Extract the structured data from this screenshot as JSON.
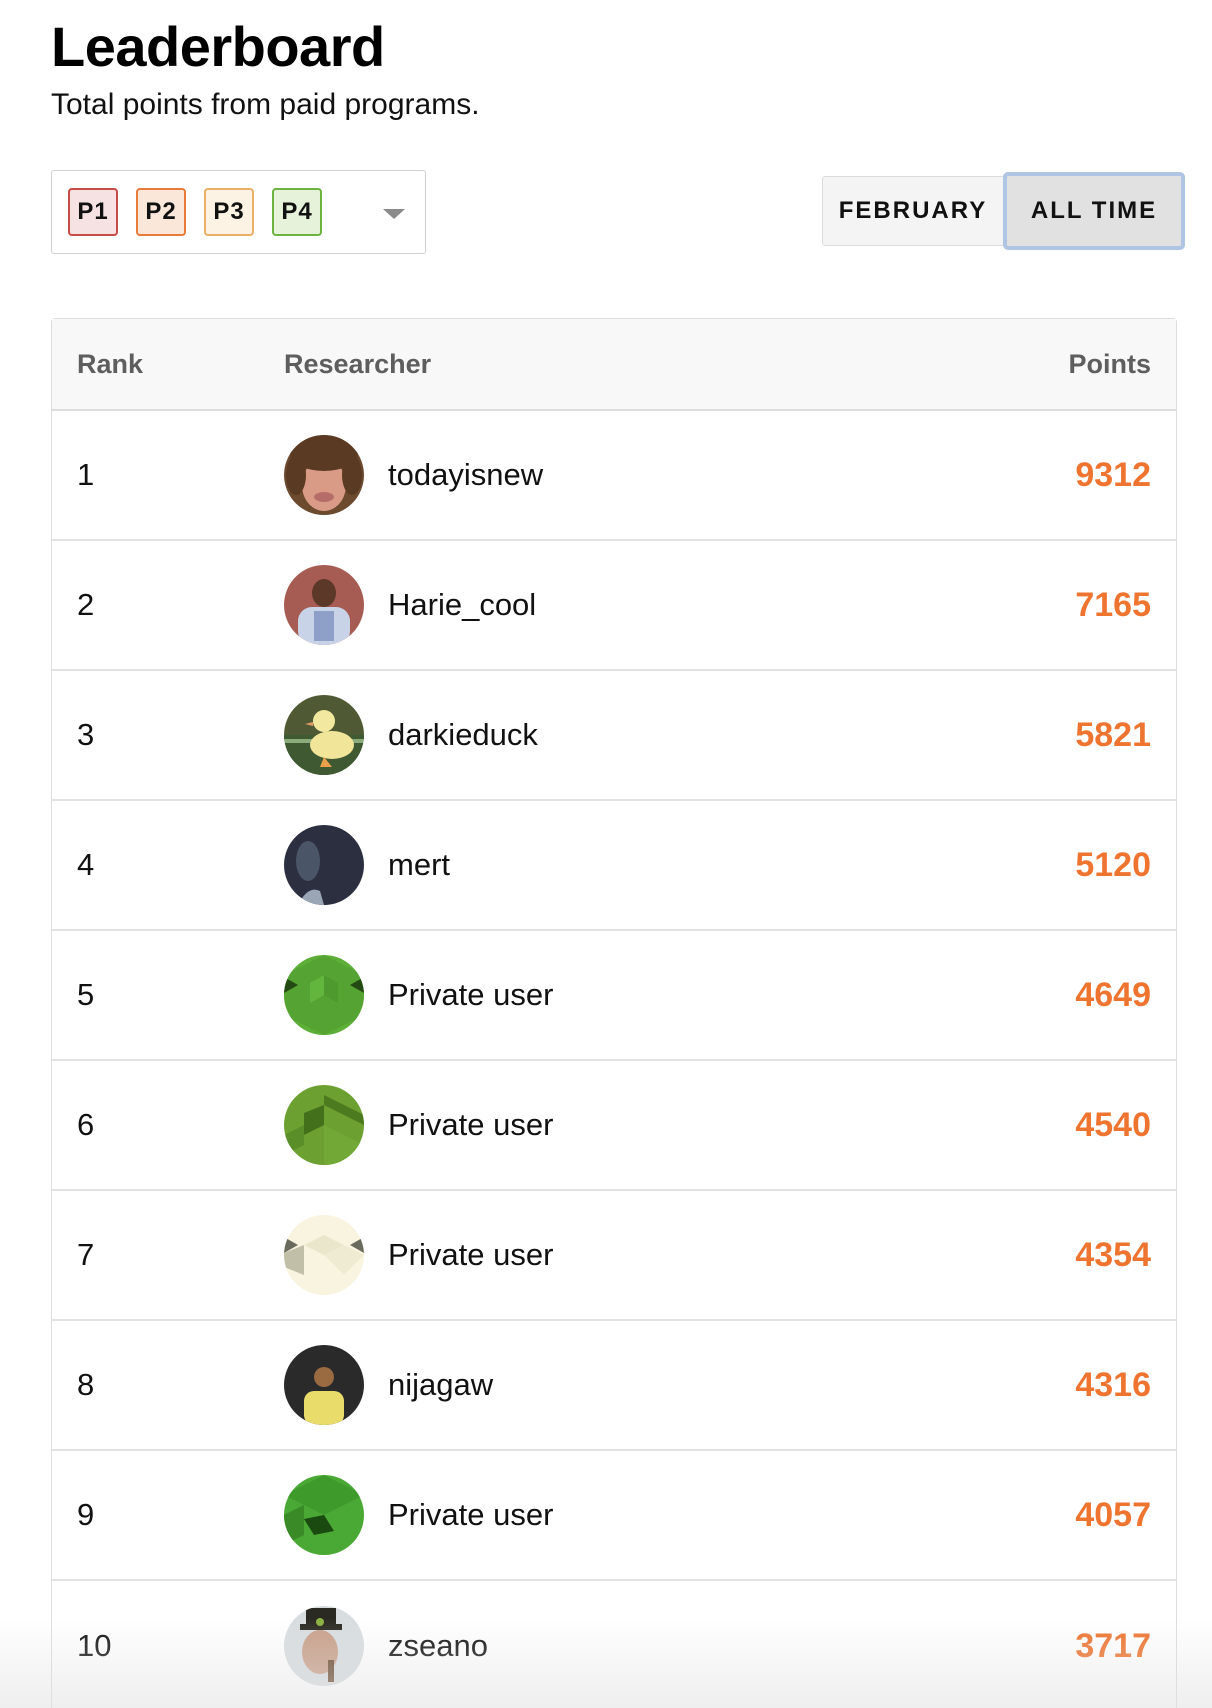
{
  "header": {
    "title": "Leaderboard",
    "subtitle": "Total points from paid programs."
  },
  "severity_filter": {
    "selected": [
      {
        "label": "P1",
        "border": "#c94b45",
        "fill": "#f6e2e2"
      },
      {
        "label": "P2",
        "border": "#ea7a3a",
        "fill": "#fbe7da"
      },
      {
        "label": "P3",
        "border": "#eab066",
        "fill": "#fdf3e4"
      },
      {
        "label": "P4",
        "border": "#6db33f",
        "fill": "#e6f2da"
      }
    ],
    "dropdown_icon": "chevron-down-icon"
  },
  "period_toggle": {
    "options": [
      "FEBRUARY",
      "ALL TIME"
    ],
    "active": "ALL TIME"
  },
  "table": {
    "columns": [
      "Rank",
      "Researcher",
      "Points"
    ],
    "rows": [
      {
        "rank": "1",
        "name": "todayisnew",
        "points": "9312",
        "avatar": "photo"
      },
      {
        "rank": "2",
        "name": "Harie_cool",
        "points": "7165",
        "avatar": "photo"
      },
      {
        "rank": "3",
        "name": "darkieduck",
        "points": "5821",
        "avatar": "duck-photo"
      },
      {
        "rank": "4",
        "name": "mert",
        "points": "5120",
        "avatar": "photo"
      },
      {
        "rank": "5",
        "name": "Private user",
        "points": "4649",
        "avatar": "identicon-green"
      },
      {
        "rank": "6",
        "name": "Private user",
        "points": "4540",
        "avatar": "identicon-olive"
      },
      {
        "rank": "7",
        "name": "Private user",
        "points": "4354",
        "avatar": "identicon-cream"
      },
      {
        "rank": "8",
        "name": "nijagaw",
        "points": "4316",
        "avatar": "photo"
      },
      {
        "rank": "9",
        "name": "Private user",
        "points": "4057",
        "avatar": "identicon-green-dark"
      },
      {
        "rank": "10",
        "name": "zseano",
        "points": "3717",
        "avatar": "photo"
      }
    ]
  },
  "colors": {
    "points": "#ee7430",
    "active_focus_ring": "#b0c4e4"
  }
}
